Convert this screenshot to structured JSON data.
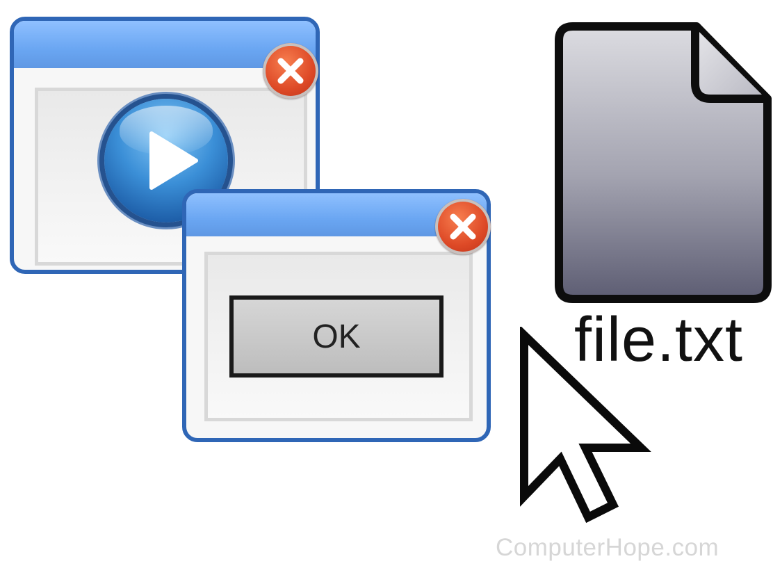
{
  "media_window": {
    "close_icon": "close-icon",
    "play_icon": "play-icon"
  },
  "dialog_window": {
    "close_icon": "close-icon",
    "ok_label": "OK"
  },
  "file": {
    "icon": "document-file-icon",
    "name": "file.txt"
  },
  "cursor_icon": "mouse-pointer-icon",
  "watermark": "ComputerHope.com",
  "colors": {
    "window_border": "#2f66b6",
    "titlebar": "#6aa6f2",
    "close_button": "#de4a27",
    "file_gradient_top": "#d9d9de",
    "file_gradient_bottom": "#5d5d73"
  }
}
